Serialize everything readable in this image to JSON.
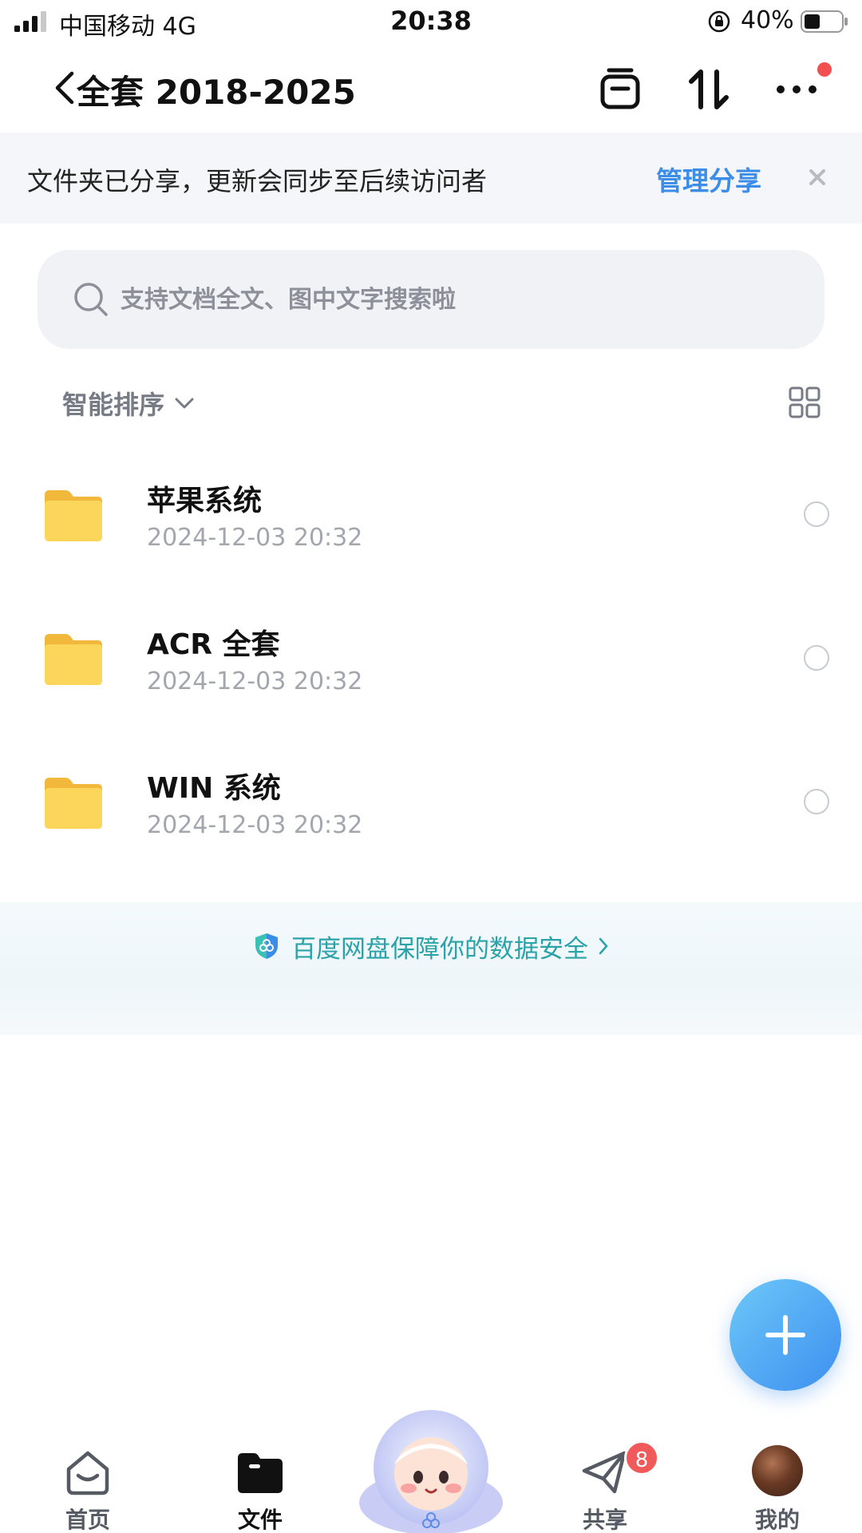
{
  "status_bar": {
    "carrier": "中国移动  4G",
    "time": "20:38",
    "battery": "40%"
  },
  "nav": {
    "title": "全套 2018-2025",
    "icons": [
      "back-icon",
      "clipboard-icon",
      "transfer-icon",
      "more-icon"
    ]
  },
  "share_banner": {
    "text": "文件夹已分享，更新会同步至后续访问者",
    "manage_label": "管理分享"
  },
  "search": {
    "placeholder": "支持文档全文、图中文字搜索啦"
  },
  "sort": {
    "label": "智能排序"
  },
  "files": [
    {
      "name": "苹果系统",
      "date": "2024-12-03 20:32"
    },
    {
      "name": "ACR 全套",
      "date": "2024-12-03 20:32"
    },
    {
      "name": "WIN 系统",
      "date": "2024-12-03 20:32"
    }
  ],
  "security_banner": {
    "text": "百度网盘保障你的数据安全"
  },
  "tabbar": {
    "home": "首页",
    "files": "文件",
    "share": "共享",
    "share_badge": "8",
    "mine": "我的"
  },
  "colors": {
    "accent": "#3b8de8",
    "security": "#2aa3a8",
    "badge": "#f05a5a",
    "folder": "#f7c948"
  }
}
